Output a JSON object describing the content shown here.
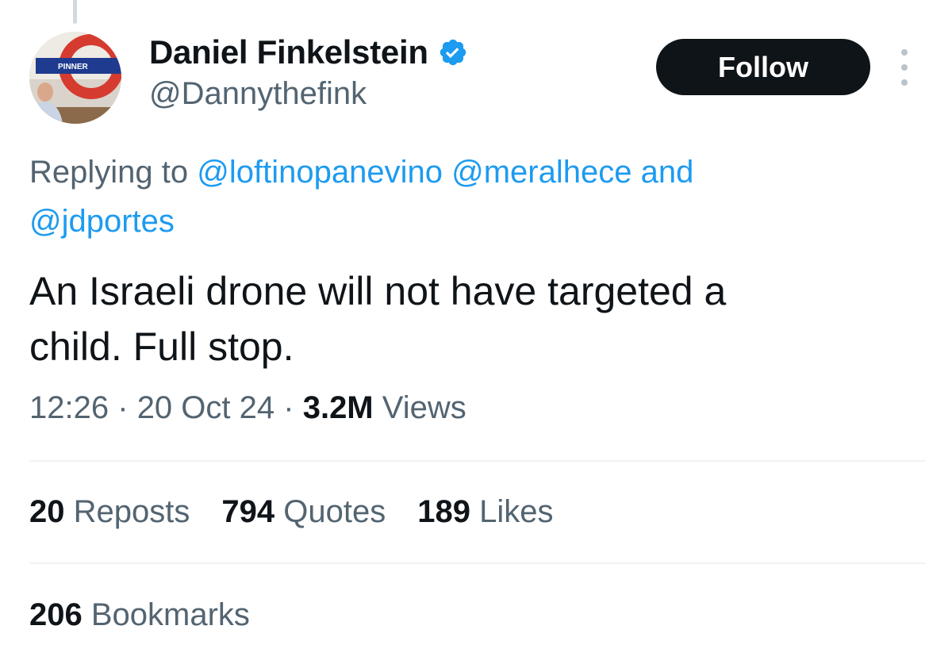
{
  "tweet": {
    "author": {
      "display_name": "Daniel Finkelstein",
      "handle": "@Dannythefink",
      "verified": true,
      "avatar_sign_text": "PINNER"
    },
    "follow_label": "Follow",
    "reply_context": {
      "prefix": "Replying to",
      "mentions": [
        "@loftinopanevino",
        "@meralhece"
      ],
      "conjunction": "and",
      "last_mention": "@jdportes"
    },
    "text_line1": "An Israeli drone will not have targeted a",
    "text_line2": "child. Full stop.",
    "time": "12:26",
    "date": "20 Oct 24",
    "separator": "·",
    "views_count": "3.2M",
    "views_label": "Views",
    "stats": {
      "reposts": {
        "count": "20",
        "label": "Reposts"
      },
      "quotes": {
        "count": "794",
        "label": "Quotes"
      },
      "likes": {
        "count": "189",
        "label": "Likes"
      }
    },
    "bookmarks": {
      "count": "206",
      "label": "Bookmarks"
    }
  },
  "colors": {
    "text_primary": "#0f1419",
    "text_secondary": "#536471",
    "link": "#1d9bf0",
    "verified_badge": "#1d9bf0",
    "divider": "#eff3f4",
    "follow_bg": "#0f1419"
  },
  "icons": [
    "verified-badge-icon",
    "more-dots-icon"
  ]
}
